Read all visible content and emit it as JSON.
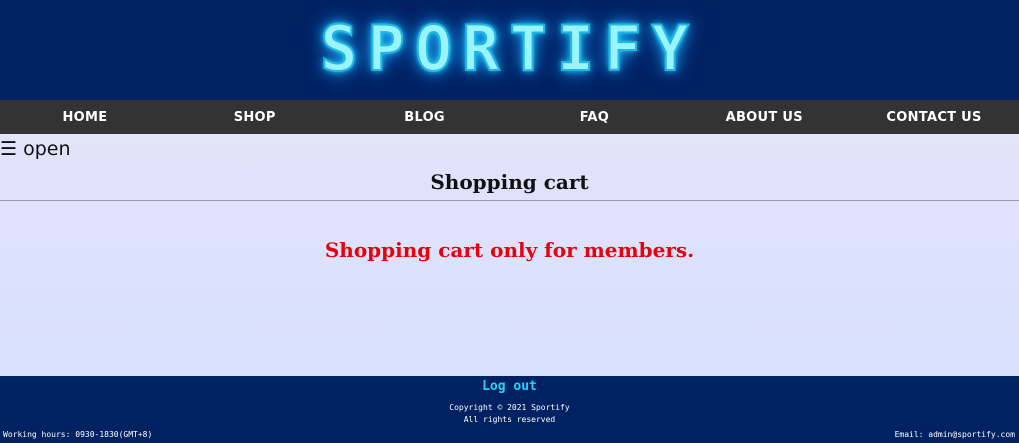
{
  "header": {
    "logo_text": "SPORTIFY"
  },
  "nav": {
    "items": [
      {
        "label": "HOME"
      },
      {
        "label": "SHOP"
      },
      {
        "label": "BLOG"
      },
      {
        "label": "FAQ"
      },
      {
        "label": "ABOUT US"
      },
      {
        "label": "CONTACT US"
      }
    ]
  },
  "main": {
    "menu_toggle": "☰ open",
    "title": "Shopping cart",
    "message": "Shopping cart only for members."
  },
  "footer": {
    "logout_label": "Log out",
    "copyright_line1": "Copyright © 2021 Sportify",
    "copyright_line2": "All rights reserved",
    "working_hours": "Working hours: 0930-1830(GMT+8)",
    "email": "Email: admin@sportify.com"
  },
  "colors": {
    "header_bg": "#002263",
    "nav_bg": "#333333",
    "logo_glow": "#2ad8ff",
    "message_red": "#e8000b",
    "logout_cyan": "#22d3f6"
  }
}
